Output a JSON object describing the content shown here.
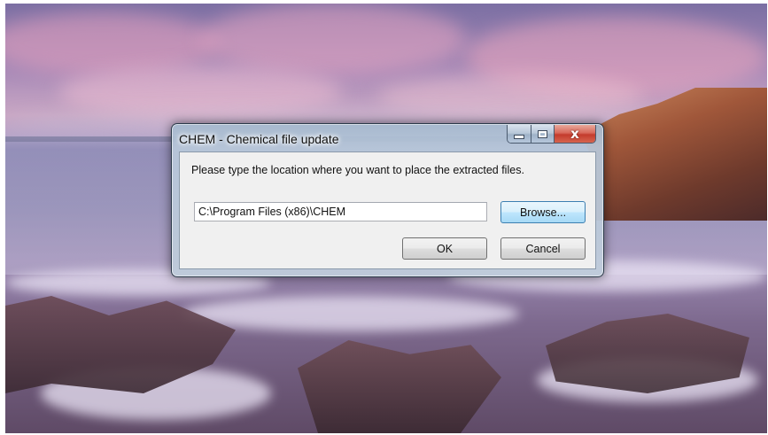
{
  "window": {
    "title": "CHEM - Chemical file update",
    "close_glyph": "x"
  },
  "dialog": {
    "prompt": "Please type the location where you want to place the extracted files.",
    "path_value": "C:\\Program Files (x86)\\CHEM",
    "browse_label": "Browse...",
    "ok_label": "OK",
    "cancel_label": "Cancel"
  },
  "colors": {
    "close_button": "#c43b2c",
    "focus_border": "#3c7fb1"
  }
}
